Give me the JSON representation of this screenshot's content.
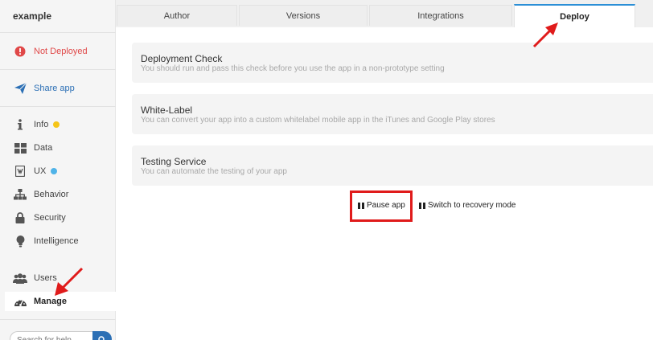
{
  "app": {
    "name": "example"
  },
  "sidebar": {
    "status": {
      "label": "Not Deployed",
      "icon": "alert-circle-icon"
    },
    "share": {
      "label": "Share app",
      "icon": "send-icon"
    },
    "items": [
      {
        "label": "Info",
        "icon": "info-icon",
        "dot": "#f5c518"
      },
      {
        "label": "Data",
        "icon": "grid-icon"
      },
      {
        "label": "UX",
        "icon": "document-icon",
        "dot": "#4fb3e8"
      },
      {
        "label": "Behavior",
        "icon": "sitemap-icon"
      },
      {
        "label": "Security",
        "icon": "lock-icon"
      },
      {
        "label": "Intelligence",
        "icon": "lightbulb-icon"
      },
      {
        "label": "Users",
        "icon": "users-icon"
      },
      {
        "label": "Manage",
        "icon": "dashboard-icon",
        "active": true
      }
    ],
    "search": {
      "placeholder": "Search for help"
    }
  },
  "tabs": [
    {
      "label": "Author"
    },
    {
      "label": "Versions"
    },
    {
      "label": "Integrations"
    },
    {
      "label": "Deploy",
      "active": true
    }
  ],
  "cards": [
    {
      "title": "Deployment Check",
      "description": "You should run and pass this check before you use the app in a non-prototype setting"
    },
    {
      "title": "White-Label",
      "description": "You can convert your app into a custom whitelabel mobile app in the iTunes and Google Play stores"
    },
    {
      "title": "Testing Service",
      "description": "You can automate the testing of your app"
    }
  ],
  "actions": {
    "pause": "Pause app",
    "recovery": "Switch to recovery mode"
  },
  "colors": {
    "accent": "#2b8fd6",
    "status_red": "#e04848",
    "annotation_red": "#e01b1b"
  }
}
